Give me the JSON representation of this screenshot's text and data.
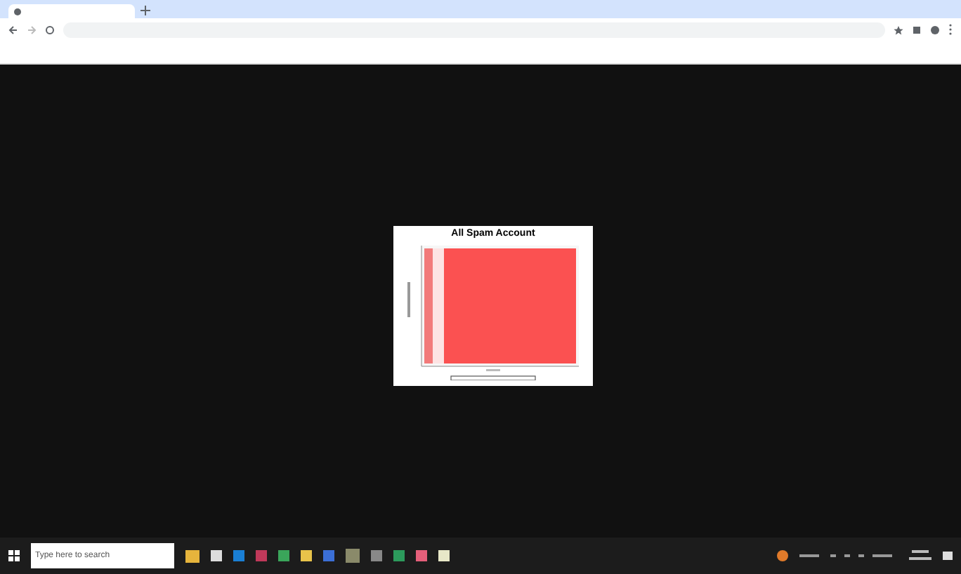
{
  "chart": {
    "title": "All Spam Account"
  },
  "taskbar": {
    "search": {
      "placeholder": "Type here to search"
    }
  }
}
